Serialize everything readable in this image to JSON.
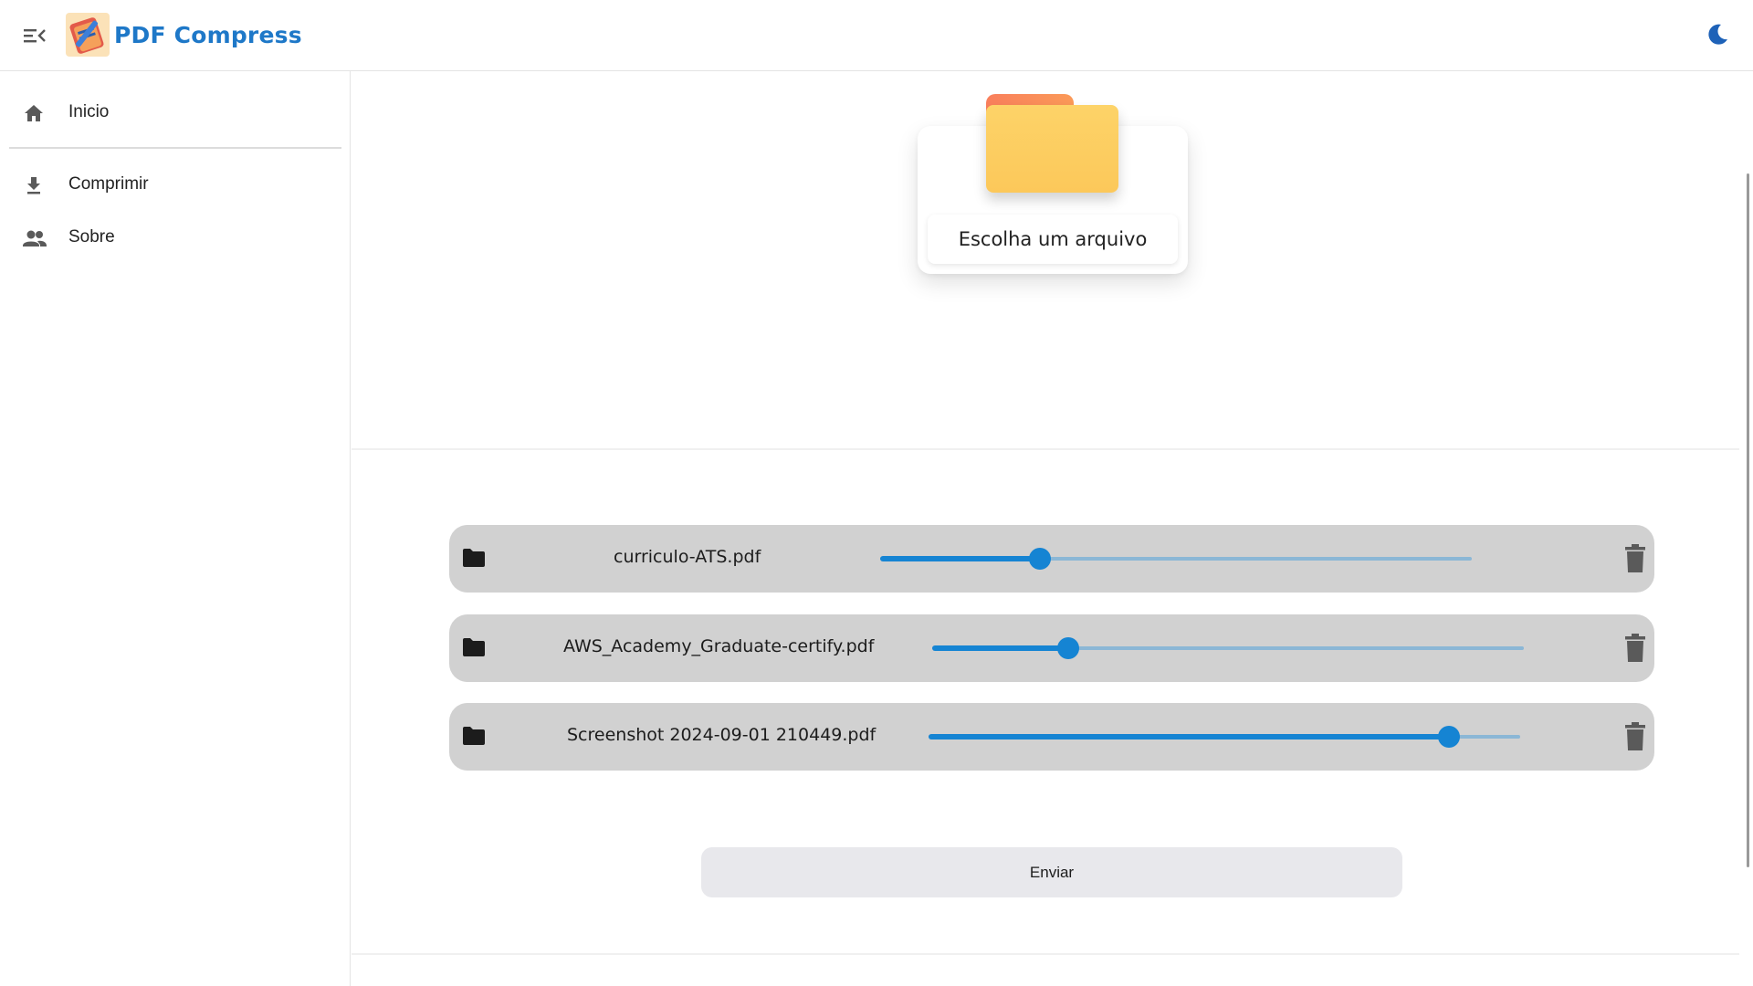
{
  "app": {
    "title": "PDF Compress",
    "brand_color": "#1e78c8"
  },
  "header": {
    "menu_icon": "menu-collapse-icon",
    "theme_icon": "moon-icon"
  },
  "sidebar": {
    "items": [
      {
        "label": "Inicio",
        "icon": "home-icon"
      },
      {
        "label": "Comprimir",
        "icon": "download-icon"
      },
      {
        "label": "Sobre",
        "icon": "people-icon"
      }
    ]
  },
  "upload": {
    "button_label": "Escolha um arquivo",
    "icon": "folder-icon"
  },
  "files": [
    {
      "name": "curriculo-ATS.pdf",
      "compression": 0.27
    },
    {
      "name": "AWS_Academy_Graduate-certify.pdf",
      "compression": 0.23
    },
    {
      "name": "Screenshot 2024-09-01 210449.pdf",
      "compression": 0.88
    }
  ],
  "actions": {
    "send_label": "Enviar"
  },
  "colors": {
    "accent": "#1584d3",
    "row_bg": "#d1d1d1",
    "folder_orange": "#f97f5c",
    "folder_yellow": "#fdd368"
  }
}
